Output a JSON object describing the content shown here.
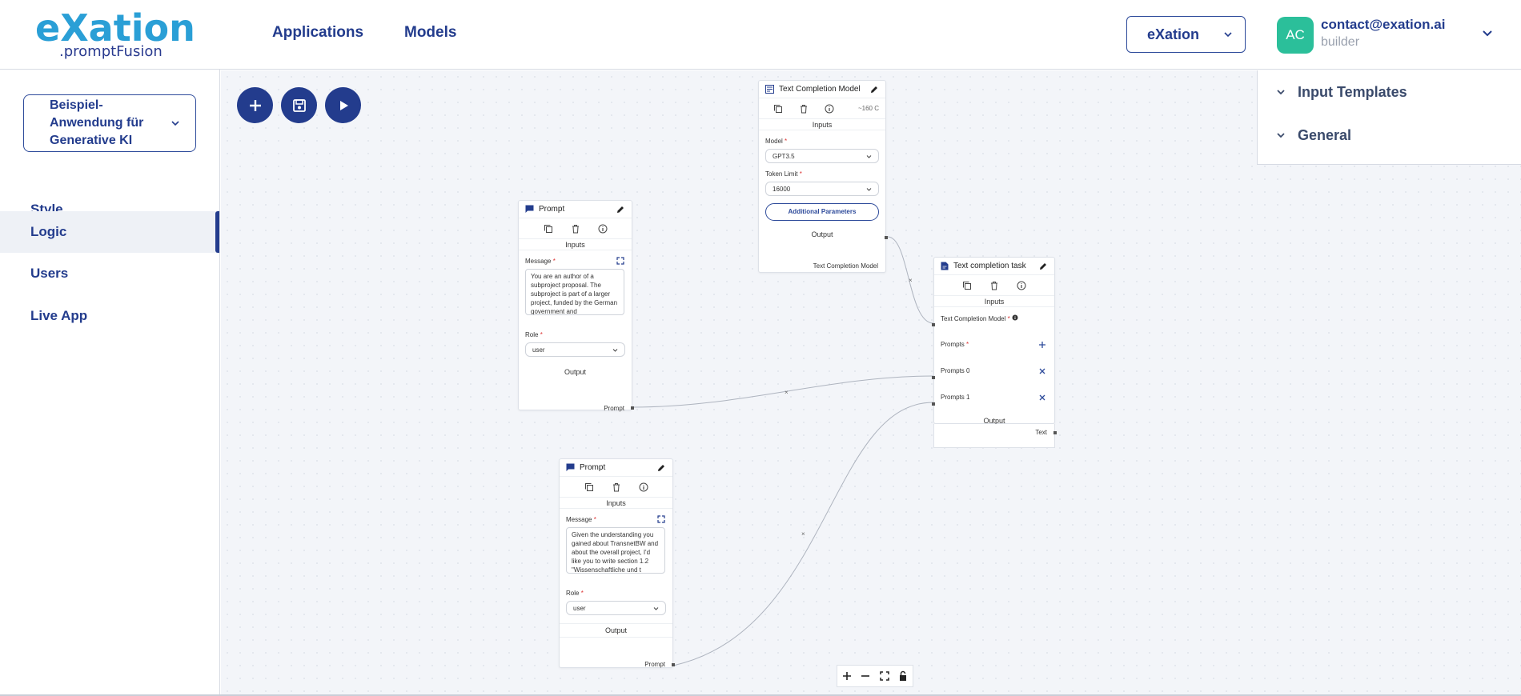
{
  "brand": {
    "name": "eXation",
    "sub": ".promptFusion"
  },
  "header": {
    "nav": [
      "Applications",
      "Models"
    ],
    "org_select": "eXation",
    "user": {
      "initials": "AC",
      "email": "contact@exation.ai",
      "role": "builder"
    }
  },
  "sidebar": {
    "app_select": "Beispiel-Anwendung für Generative KI",
    "items": [
      {
        "label": "Style",
        "active": false
      },
      {
        "label": "Logic",
        "active": true
      },
      {
        "label": "Users",
        "active": false
      },
      {
        "label": "Live App",
        "active": false
      }
    ]
  },
  "right_panel": {
    "sections": [
      "Input Templates",
      "General"
    ]
  },
  "nodes": {
    "tcm": {
      "title": "Text Completion Model",
      "cost": "~160 C",
      "inputs_label": "Inputs",
      "model_label": "Model",
      "model_value": "GPT3.5",
      "token_label": "Token Limit",
      "token_value": "16000",
      "additional": "Additional Parameters",
      "output_label": "Output",
      "output_item": "Text Completion Model"
    },
    "prompt1": {
      "title": "Prompt",
      "inputs_label": "Inputs",
      "message_label": "Message",
      "message": "You are an author of a subproject proposal.\nThe subproject is part of a larger project, funded by the German government and",
      "role_label": "Role",
      "role_value": "user",
      "output_label": "Output",
      "output_item": "Prompt"
    },
    "prompt2": {
      "title": "Prompt",
      "inputs_label": "Inputs",
      "message_label": "Message",
      "message": "Given the understanding you gained about TransnetBW and about the overall project, I'd like you to write section 1.2 \"Wissenschaftliche und t",
      "role_label": "Role",
      "role_value": "user",
      "output_label": "Output",
      "output_item": "Prompt"
    },
    "task": {
      "title": "Text completion task",
      "inputs_label": "Inputs",
      "in_model": "Text Completion Model",
      "in_prompts": "Prompts",
      "in_prompts0": "Prompts 0",
      "in_prompts1": "Prompts 1",
      "output_label": "Output",
      "output_item": "Text"
    }
  },
  "colors": {
    "primary": "#233c8d",
    "accent": "#2a9fd6",
    "avatar": "#2bbf9a"
  }
}
